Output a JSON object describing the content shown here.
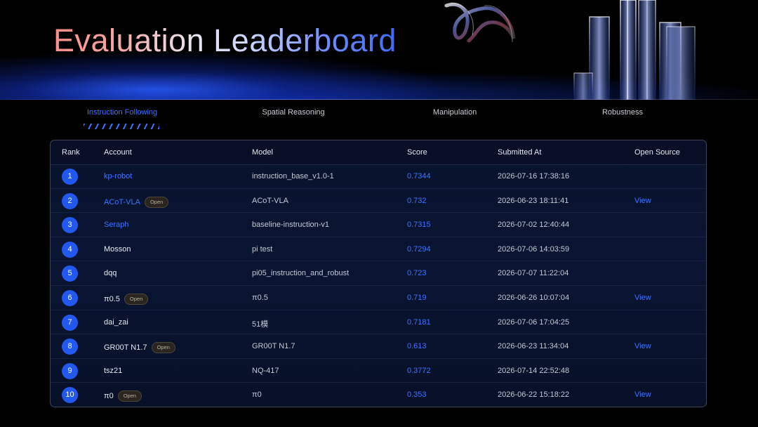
{
  "header": {
    "title": "Evaluation Leaderboard"
  },
  "tabs": [
    {
      "label": "Instruction Following",
      "active": true
    },
    {
      "label": "Spatial Reasoning",
      "active": false
    },
    {
      "label": "Manipulation",
      "active": false
    },
    {
      "label": "Robustness",
      "active": false
    }
  ],
  "table": {
    "columns": {
      "rank": "Rank",
      "account": "Account",
      "model": "Model",
      "score": "Score",
      "submitted": "Submitted At",
      "source": "Open Source"
    },
    "rows": [
      {
        "rank": "1",
        "account": "kp-robot",
        "account_linked": true,
        "badge": "",
        "model": "instruction_base_v1.0-1",
        "score": "0.7344",
        "submitted": "2026-07-16 17:38:16",
        "source": ""
      },
      {
        "rank": "2",
        "account": "ACoT-VLA",
        "account_linked": true,
        "badge": "Open",
        "model": "ACoT-VLA",
        "score": "0.732",
        "submitted": "2026-06-23 18:11:41",
        "source": "View"
      },
      {
        "rank": "3",
        "account": "Seraph",
        "account_linked": true,
        "badge": "",
        "model": "baseline-instruction-v1",
        "score": "0.7315",
        "submitted": "2026-07-02 12:40:44",
        "source": ""
      },
      {
        "rank": "4",
        "account": "Mosson",
        "account_linked": false,
        "badge": "",
        "model": "pi test",
        "score": "0.7294",
        "submitted": "2026-07-06 14:03:59",
        "source": ""
      },
      {
        "rank": "5",
        "account": "dqq",
        "account_linked": false,
        "badge": "",
        "model": "pi05_instruction_and_robust",
        "score": "0.723",
        "submitted": "2026-07-07 11:22:04",
        "source": ""
      },
      {
        "rank": "6",
        "account": "π0.5",
        "account_linked": false,
        "badge": "Open",
        "model": "π0.5",
        "score": "0.719",
        "submitted": "2026-06-26 10:07:04",
        "source": "View"
      },
      {
        "rank": "7",
        "account": "dai_zai",
        "account_linked": false,
        "badge": "",
        "model": "51模",
        "score": "0.7181",
        "submitted": "2026-07-06 17:04:25",
        "source": ""
      },
      {
        "rank": "8",
        "account": "GR00T N1.7",
        "account_linked": false,
        "badge": "Open",
        "model": "GR00T N1.7",
        "score": "0.613",
        "submitted": "2026-06-23 11:34:04",
        "source": "View"
      },
      {
        "rank": "9",
        "account": "tsz21",
        "account_linked": false,
        "badge": "",
        "model": "NQ-417",
        "score": "0.3772",
        "submitted": "2026-07-14 22:52:48",
        "source": ""
      },
      {
        "rank": "10",
        "account": "π0",
        "account_linked": false,
        "badge": "Open",
        "model": "π0",
        "score": "0.353",
        "submitted": "2026-06-22 15:18:22",
        "source": "View"
      }
    ]
  },
  "colors": {
    "accent": "#3d73ff",
    "rank_badge": "#2358ef",
    "background": "#000000",
    "panel": "#0a1533"
  }
}
